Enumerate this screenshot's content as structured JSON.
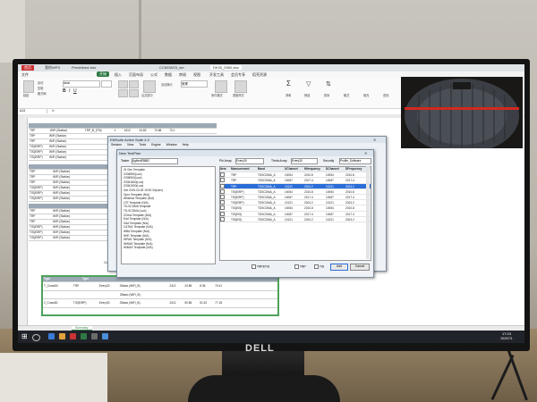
{
  "colors": {
    "accent": "#2f7a44",
    "selection": "#2a6dd8",
    "grid_header": "#9ba8b5",
    "green_border": "#4da35a"
  },
  "browser_tabs": [
    "首页",
    "我的WPS",
    "Predefined.xlsx",
    "CCMSW23_ser",
    "DK30_0960.xlsx"
  ],
  "ribbon_tabs": [
    "文件",
    "开始",
    "插入",
    "页面布局",
    "公式",
    "数据",
    "审阅",
    "视图",
    "开发工具",
    "会员专享",
    "稻壳资源"
  ],
  "ribbon_labels": [
    "粘贴",
    "剪切",
    "复制",
    "格式刷",
    "Arial",
    "合并居中",
    "自动换行",
    "常规",
    "条件格式",
    "表格样式",
    "求和",
    "筛选",
    "排序",
    "格式",
    "填充",
    "查找"
  ],
  "name_box": "A13",
  "sheet_top_rows": [
    [
      "TRP",
      "WiFi (Station)",
      "TRP_B_(TM)",
      "1",
      "2412",
      "24.83",
      "70.88",
      "73.1"
    ],
    [
      "TRP",
      "WiFi (Station)",
      "",
      "",
      "",
      "",
      "",
      ""
    ],
    [
      "TRP",
      "WiFi (Station)",
      "",
      "",
      "",
      "",
      "",
      ""
    ],
    [
      "TIS(EIRP)",
      "WiFi (Station)",
      "",
      "",
      "",
      "",
      "",
      ""
    ],
    [
      "TIS(EIRP)",
      "WiFi (Station)",
      "",
      "",
      "",
      "",
      "",
      ""
    ],
    [
      "TIS(EIRP)",
      "WiFi (Station)",
      "",
      "",
      "",
      "",
      "",
      ""
    ]
  ],
  "sheet_mid_rows": [
    [
      "TRP",
      "WiFi (Station)"
    ],
    [
      "TRP",
      "WiFi (Station)"
    ],
    [
      "TRP",
      "WiFi (Station)"
    ],
    [
      "TIS(EIRP)",
      "WiFi (Station)"
    ],
    [
      "TIS(EIRP)",
      "WiFi (Station)"
    ],
    [
      "TIS(EIRP)",
      "WiFi (Station)"
    ]
  ],
  "sheet_low_rows": [
    [
      "TRP",
      "WiFi (Station)"
    ],
    [
      "TRP",
      "WiFi (Station)"
    ],
    [
      "TRP",
      "WiFi (Station)"
    ],
    [
      "TIS(EIRP)",
      "WiFi (Station)"
    ],
    [
      "TIS(EIRP)",
      "WiFi (Station)"
    ],
    [
      "TIS(EIRP)",
      "WiFi (Station)"
    ]
  ],
  "bottom_block": {
    "headers": [
      "Type",
      "Type"
    ],
    "rows": [
      [
        "T_Cross50",
        "TRP",
        "Every30",
        "2Basic (WiFi_B)",
        "",
        "2412",
        "24.85",
        "8.36",
        "70.41"
      ],
      [
        "",
        "",
        "",
        "2Basic (WiFi_B)",
        "",
        "",
        "",
        "",
        ""
      ],
      [
        "2_Cross50",
        "TIS(EIRP)",
        "Every30",
        "2Basic (WiFi_B)",
        "",
        "2412",
        "50.85",
        "51.52",
        "77.18"
      ]
    ],
    "footer": [
      "Custom: Sets24",
      "System: Coreg Sets24",
      "Engine: Idle"
    ]
  },
  "sheet_tabs": [
    "Summary"
  ],
  "app_dialog": {
    "title": "EMSuite Active Suite 4.0",
    "menu": [
      "Session",
      "View",
      "Tools",
      "Engine",
      "Window",
      "Help"
    ]
  },
  "testplan": {
    "title": "New TestPlan",
    "tester_label": "Tester",
    "tester_value": "AgilentE8862",
    "phi_label": "Phi Array",
    "phi_value": "Every30",
    "theta_label": "Theta Array",
    "theta_value": "Every30",
    "security_label": "Security",
    "security_value": "Profile_Software",
    "tree": [
      "Gl Gen Template",
      "GSM850(Low)",
      "GSM900(Low)",
      "GSM1800(Low)",
      "GSM1900(Low)",
      "Get 2019-03-05 19:52:34(user)",
      "Opro Template (N/A)",
      "Wireless Template (N/A)",
      "LTE Template (N/A)",
      "TD-SCDMA Template",
      "TD-SCDMA (Low)",
      "CDma Template (N/A)",
      "Edd Template (N/A)",
      "Gdd Template (N/A)",
      "CATM1 Template (N/A)",
      "WBA Template (N/A)",
      "WiFi Template (N/A)",
      "WPAN Template (N/A)",
      "WWAN Template (N/A)",
      "WiMAX Template (N/A)"
    ],
    "columns": [
      "Item",
      "Measurement",
      "Band",
      "UChannel",
      "Mfrequency",
      "DChannel",
      "DFrequency"
    ],
    "rows": [
      [
        "",
        "TRP",
        "TDSCDMA_A",
        "10054",
        "2010.8",
        "10054",
        "2010.8"
      ],
      [
        "",
        "TRP",
        "TDSCDMA_A",
        "10087",
        "2017.4",
        "10087",
        "2017.4"
      ],
      [
        "",
        "TRP",
        "TDSCDMA_A",
        "10121",
        "2024.2",
        "10121",
        "2024.2"
      ],
      [
        "",
        "TIS(EIRP)",
        "TDSCDMA_A",
        "10054",
        "2010.8",
        "10054",
        "2010.8"
      ],
      [
        "",
        "TIS(EIRP)",
        "TDSCDMA_A",
        "10087",
        "2017.4",
        "10087",
        "2017.4"
      ],
      [
        "",
        "TIS(EIRP)",
        "TDSCDMA_A",
        "10121",
        "2024.2",
        "10121",
        "2024.2"
      ],
      [
        "",
        "TIS(EIS)",
        "TDSCDMA_A",
        "10054",
        "2010.8",
        "10054",
        "2010.8"
      ],
      [
        "",
        "TIS(EIS)",
        "TDSCDMA_A",
        "10087",
        "2017.4",
        "10087",
        "2017.4"
      ],
      [
        "",
        "TIS(EIS)",
        "TDSCDMA_A",
        "10121",
        "2024.2",
        "10121",
        "2024.2"
      ]
    ],
    "selected_row": 2,
    "checkbox_labels": [
      "TRP&TIS",
      "TRP",
      "TIS"
    ],
    "add_label": "Add",
    "cancel_label": "Cancel"
  },
  "taskbar": {
    "time": "17:23",
    "date": "2020/7/1"
  },
  "monitor_logo": "DELL"
}
